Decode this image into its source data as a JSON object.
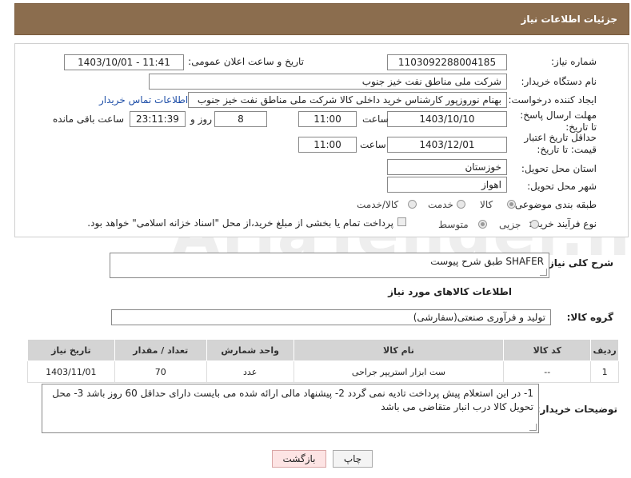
{
  "header": {
    "title": "جزئیات اطلاعات نیاز"
  },
  "form": {
    "need_number": {
      "label": "شماره نیاز:",
      "value": "1103092288004185"
    },
    "announce_datetime": {
      "label": "تاریخ و ساعت اعلان عمومی:",
      "value": "1403/10/01 - 11:41"
    },
    "buyer_org": {
      "label": "نام دستگاه خریدار:",
      "value": "شرکت ملی مناطق نفت خیز جنوب"
    },
    "requester": {
      "label": "ایجاد کننده درخواست:",
      "value": "بهنام  نوروزپور کارشناس خرید داخلی کالا شرکت ملی مناطق نفت خیز جنوب",
      "contact_link": "اطلاعات تماس خریدار"
    },
    "deadline": {
      "label": "مهلت ارسال پاسخ: تا تاریخ:",
      "date": "1403/10/10",
      "time_label": "ساعت",
      "time": "11:00",
      "days": "8",
      "days_label": "روز و",
      "remaining_time": "23:11:39",
      "remaining_label": "ساعت باقی مانده"
    },
    "price_validity": {
      "label": "حداقل تاریخ اعتبار قیمت: تا تاریخ:",
      "date": "1403/12/01",
      "time_label": "ساعت",
      "time": "11:00"
    },
    "province": {
      "label": "استان محل تحویل:",
      "value": "خوزستان"
    },
    "city": {
      "label": "شهر محل تحویل:",
      "value": "اهواز"
    },
    "category": {
      "label": "طبقه بندی موضوعی:",
      "options": [
        "کالا",
        "خدمت",
        "کالا/خدمت"
      ]
    },
    "purchase_type": {
      "label": "نوع فرآیند خرید :",
      "options": [
        "جزیی",
        "متوسط"
      ],
      "checkbox_text": "پرداخت تمام یا بخشی از مبلغ خرید،از محل \"اسناد خزانه اسلامی\" خواهد بود."
    }
  },
  "description": {
    "label": "شرح کلی نیاز:",
    "value": "SHAFER  طبق شرح پیوست"
  },
  "goods_section_title": "اطلاعات کالاهای مورد نیاز",
  "goods_group": {
    "label": "گروه کالا:",
    "value": "تولید و فرآوری صنعتی(سفارشی)"
  },
  "table": {
    "headers": [
      "ردیف",
      "کد کالا",
      "نام کالا",
      "واحد شمارش",
      "تعداد / مقدار",
      "تاریخ نیاز"
    ],
    "rows": [
      [
        "1",
        "--",
        "ست ابزار استریپر جراحی",
        "عدد",
        "70",
        "1403/11/01"
      ]
    ]
  },
  "buyer_notes": {
    "label": "توضیحات خریدار:",
    "value": "1-  در این استعلام پیش پرداخت تادیه نمی گردد  2- پیشنهاد مالی ارائه شده می بایست دارای حداقل 60 روز باشد  3- محل تحویل کالا درب انبار متقاضی می باشد"
  },
  "buttons": {
    "print": "چاپ",
    "back": "بازگشت"
  }
}
